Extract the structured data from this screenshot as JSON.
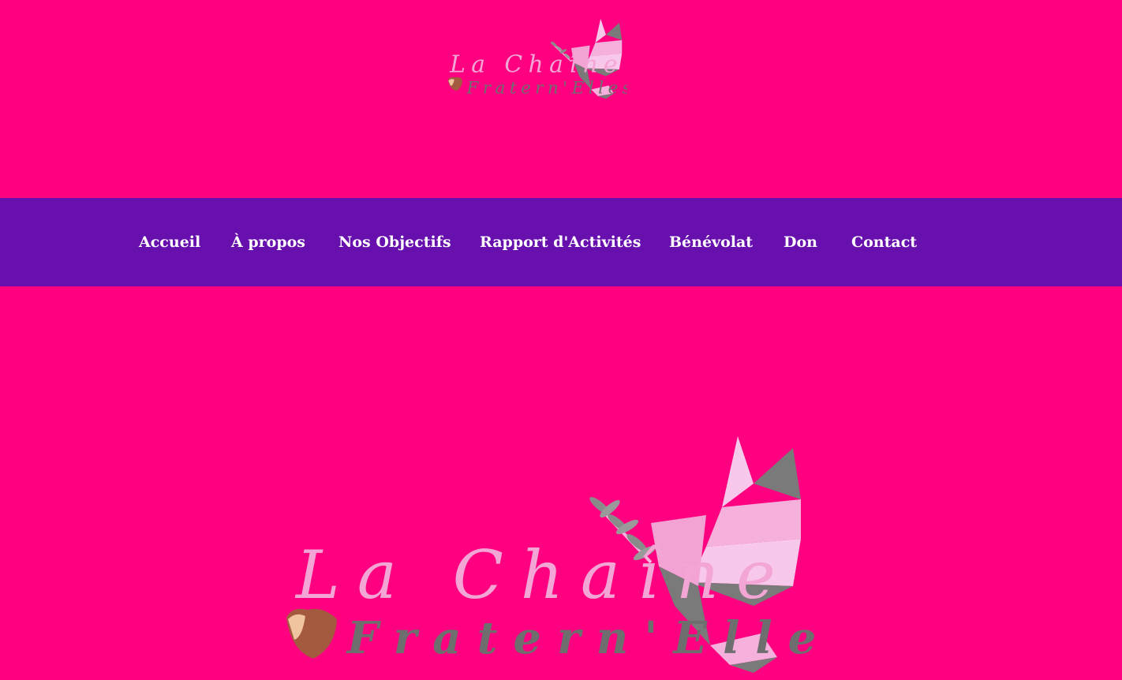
{
  "brand": {
    "line1": "La Chaîne",
    "line2": "Fratern'Elles"
  },
  "nav": {
    "items": [
      {
        "label": "Accueil"
      },
      {
        "label": "À propos"
      },
      {
        "label": "Nos Objectifs"
      },
      {
        "label": "Rapport d'Activités"
      },
      {
        "label": "Bénévolat"
      },
      {
        "label": "Don"
      },
      {
        "label": "Contact"
      }
    ]
  },
  "colors": {
    "background": "#ff0080",
    "nav_bar": "#6710ad",
    "nav_text": "#ffffff",
    "logo_pink": "#f4a6d3",
    "logo_grey": "#7a7a7a"
  },
  "icons": {
    "logo_mark": "dove-icon",
    "hands": "pinky-promise-hands-icon"
  }
}
